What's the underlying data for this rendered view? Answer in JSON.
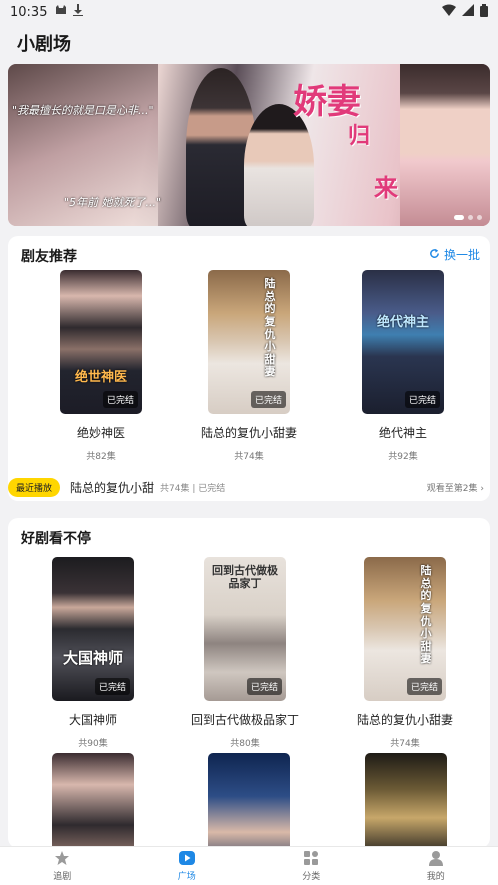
{
  "status_bar": {
    "time": "10:35"
  },
  "page_title": "小剧场",
  "banner": {
    "title_line1": "娇妻",
    "title_line2": "归",
    "title_line3": "来",
    "quote1": "\"我最擅长的就是口是心非...\"",
    "quote2": "\"5年前 她就死了...\""
  },
  "recommend": {
    "title": "剧友推荐",
    "refresh_label": "换一批",
    "items": [
      {
        "title": "绝妙神医",
        "count": "共82集",
        "badge": "已完结",
        "poster_text": "绝世神医"
      },
      {
        "title": "陆总的复仇小甜妻",
        "count": "共74集",
        "badge": "已完结",
        "poster_text": "陆总的复仇小甜妻"
      },
      {
        "title": "绝代神主",
        "count": "共92集",
        "badge": "已完结",
        "poster_text": "绝代神主"
      }
    ],
    "recent": {
      "tag": "最近播放",
      "name": "陆总的复仇小甜",
      "meta": "共74集 | 已完结",
      "progress": "观看至第2集"
    }
  },
  "binge": {
    "title": "好剧看不停",
    "items": [
      {
        "title": "大国神师",
        "count": "共90集",
        "badge": "已完结",
        "poster_text": "大国神师"
      },
      {
        "title": "回到古代做极品家丁",
        "count": "共80集",
        "badge": "已完结",
        "poster_text": "回到古代做极品家丁"
      },
      {
        "title": "陆总的复仇小甜妻",
        "count": "共74集",
        "badge": "已完结",
        "poster_text": "陆总的复仇小甜妻"
      }
    ]
  },
  "tabbar": {
    "tabs": [
      {
        "label": "追剧",
        "icon": "star-icon"
      },
      {
        "label": "广场",
        "icon": "play-icon"
      },
      {
        "label": "分类",
        "icon": "category-icon"
      },
      {
        "label": "我的",
        "icon": "user-icon"
      }
    ]
  },
  "colors": {
    "accent": "#1e88e5",
    "badge_yellow": "#ffd600"
  }
}
